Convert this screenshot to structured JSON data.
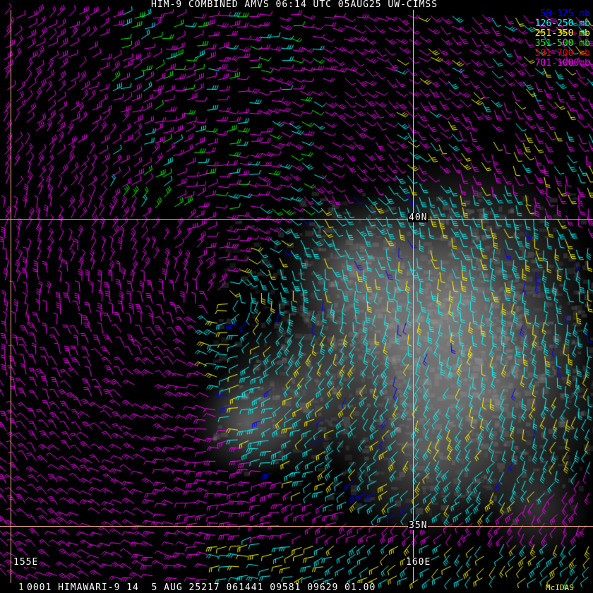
{
  "title": "HIM-9 COMBINED AMVS 06:14 UTC 05AUG25 UW-CIMSS",
  "legend": [
    {
      "label": "50-125 mb",
      "color": "#0000ff"
    },
    {
      "label": "126-250 mb",
      "color": "#00ffff"
    },
    {
      "label": "251-350 mb",
      "color": "#ffff00"
    },
    {
      "label": "351-500 mb",
      "color": "#00ff00"
    },
    {
      "label": "501-700 mb",
      "color": "#ff0000"
    },
    {
      "label": "701-1000mb",
      "color": "#ff00ff"
    }
  ],
  "grid": {
    "lat_labels": [
      "40N",
      "35N"
    ],
    "lon_labels": [
      "155E",
      "160E"
    ],
    "line_color": "#ffb090"
  },
  "footer": {
    "frame_number": "1",
    "info": "0001 HIMAWARI-9 14  5 AUG 25217 061441 09581 09629 01.00",
    "software": "McIDAS"
  }
}
